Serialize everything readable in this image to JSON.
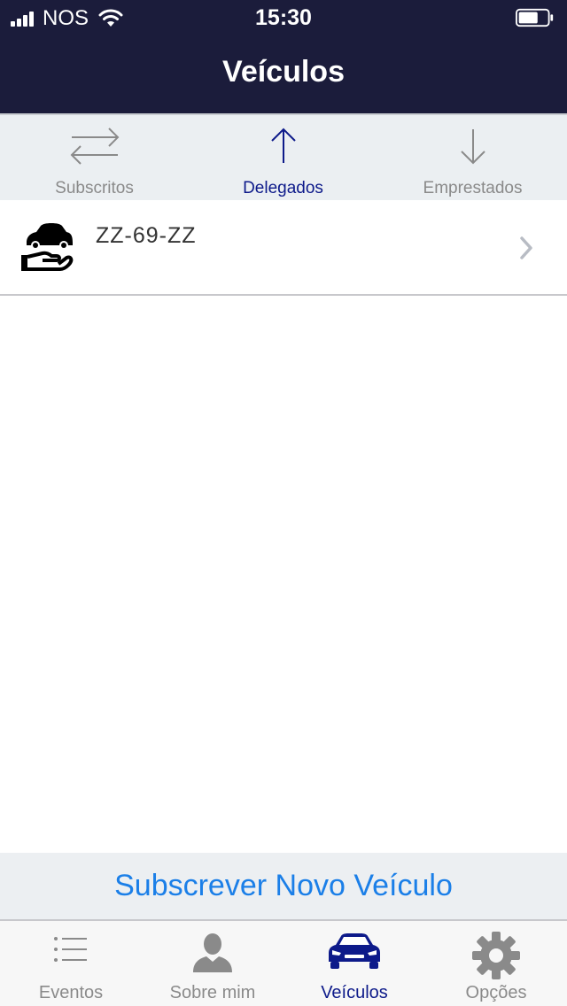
{
  "status_bar": {
    "carrier": "NOS",
    "time": "15:30"
  },
  "nav": {
    "title": "Veículos"
  },
  "segments": [
    {
      "label": "Subscritos",
      "icon": "swap-arrows-icon",
      "active": false
    },
    {
      "label": "Delegados",
      "icon": "arrow-up-icon",
      "active": true
    },
    {
      "label": "Emprestados",
      "icon": "arrow-down-icon",
      "active": false
    }
  ],
  "vehicles": [
    {
      "plate": "ZZ-69-ZZ",
      "icon": "car-hand-icon"
    }
  ],
  "subscribe": {
    "label": "Subscrever Novo Veículo"
  },
  "tabs": [
    {
      "label": "Eventos",
      "icon": "list-icon",
      "active": false
    },
    {
      "label": "Sobre mim",
      "icon": "person-icon",
      "active": false
    },
    {
      "label": "Veículos",
      "icon": "car-icon",
      "active": true
    },
    {
      "label": "Opções",
      "icon": "gear-icon",
      "active": false
    }
  ],
  "colors": {
    "header_bg": "#1b1c3b",
    "accent": "#0d1a8a",
    "link_blue": "#1b7fe8",
    "inactive": "#8a8a8a"
  }
}
